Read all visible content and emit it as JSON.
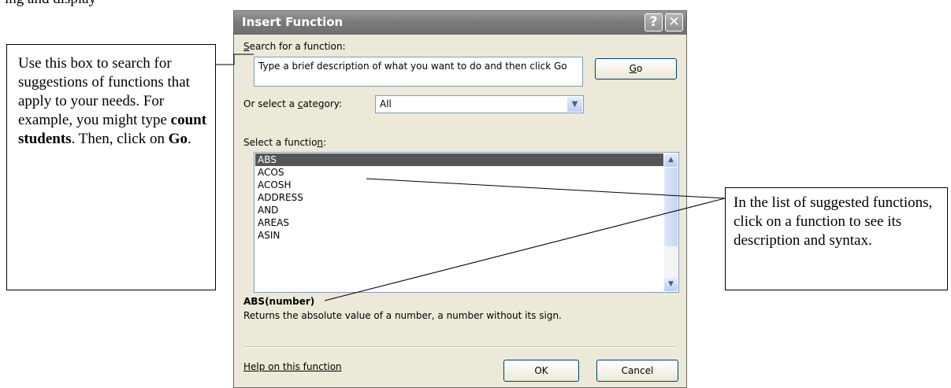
{
  "page": {
    "top_text": "ing and display"
  },
  "callouts": {
    "left": {
      "text_before": "Use this box to search for suggestions of functions that apply to your needs. For example, you might type ",
      "bold_1": "count students",
      "text_middle": ".  Then, click on ",
      "bold_2": "Go",
      "text_after": "."
    },
    "right": {
      "text": "In the list of suggested functions, click on a function to see its description and syntax."
    }
  },
  "dialog": {
    "title": "Insert Function",
    "help_button": "?",
    "close_button": "✕",
    "search_label_prefix": "S",
    "search_label_rest": "earch for a function:",
    "search_value": "Type a brief description of what you want to do and then click Go",
    "go_label_u": "G",
    "go_label_rest": "o",
    "category_label_before": "Or select a ",
    "category_label_u": "c",
    "category_label_after": "ategory:",
    "category_value": "All",
    "function_label_before": "Select a functio",
    "function_label_u": "n",
    "function_label_after": ":",
    "functions": [
      "ABS",
      "ACOS",
      "ACOSH",
      "ADDRESS",
      "AND",
      "AREAS",
      "ASIN"
    ],
    "selected_function": "ABS",
    "syntax": "ABS(number)",
    "description": "Returns the absolute value of a number, a number without its sign.",
    "help_link": "Help on this function",
    "ok_label": "OK",
    "cancel_label": "Cancel"
  },
  "colors": {
    "dialog_bg": "#ece9d8",
    "titlebar": "#7b7b7b",
    "selection": "#565656"
  },
  "icons": {
    "select_arrow": "chevron-down-icon",
    "scroll_up": "scroll-up-icon",
    "scroll_down": "scroll-down-icon"
  }
}
